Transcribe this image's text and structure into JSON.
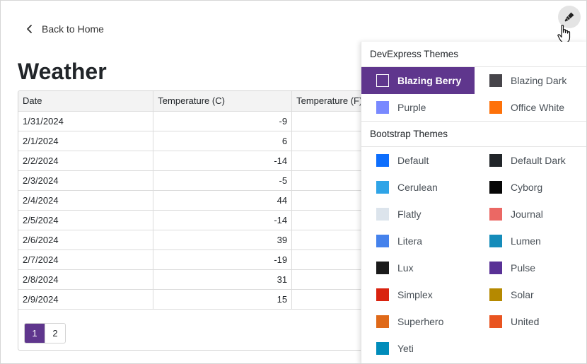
{
  "nav": {
    "back_label": "Back to Home"
  },
  "page": {
    "title": "Weather"
  },
  "grid": {
    "columns": [
      "Date",
      "Temperature (C)",
      "Temperature (F)"
    ],
    "rows": [
      {
        "date": "1/31/2024",
        "temp_c": "-9"
      },
      {
        "date": "2/1/2024",
        "temp_c": "6"
      },
      {
        "date": "2/2/2024",
        "temp_c": "-14"
      },
      {
        "date": "2/3/2024",
        "temp_c": "-5"
      },
      {
        "date": "2/4/2024",
        "temp_c": "44"
      },
      {
        "date": "2/5/2024",
        "temp_c": "-14"
      },
      {
        "date": "2/6/2024",
        "temp_c": "39"
      },
      {
        "date": "2/7/2024",
        "temp_c": "-19"
      },
      {
        "date": "2/8/2024",
        "temp_c": "31"
      },
      {
        "date": "2/9/2024",
        "temp_c": "15"
      }
    ],
    "pager": {
      "pages": [
        "1",
        "2"
      ],
      "active": "1"
    }
  },
  "theme_button_icon": "paintbrush-icon",
  "theme_panel": {
    "devexpress_header": "DevExpress Themes",
    "devexpress": [
      {
        "name": "Blazing Berry",
        "color": "#5f368d",
        "selected": true
      },
      {
        "name": "Blazing Dark",
        "color": "#46444a",
        "selected": false
      },
      {
        "name": "Purple",
        "color": "#7989ff",
        "selected": false
      },
      {
        "name": "Office White",
        "color": "#fe7109",
        "selected": false
      }
    ],
    "bootstrap_header": "Bootstrap Themes",
    "bootstrap": [
      {
        "name": "Default",
        "color": "#0d6efd"
      },
      {
        "name": "Default Dark",
        "color": "#212529"
      },
      {
        "name": "Cerulean",
        "color": "#2fa4e7"
      },
      {
        "name": "Cyborg",
        "color": "#060606"
      },
      {
        "name": "Flatly",
        "color": "#dce4ec"
      },
      {
        "name": "Journal",
        "color": "#eb6864"
      },
      {
        "name": "Litera",
        "color": "#4582ec"
      },
      {
        "name": "Lumen",
        "color": "#158cba"
      },
      {
        "name": "Lux",
        "color": "#1a1a1a"
      },
      {
        "name": "Pulse",
        "color": "#593196"
      },
      {
        "name": "Simplex",
        "color": "#d9230f"
      },
      {
        "name": "Solar",
        "color": "#b58900"
      },
      {
        "name": "Superhero",
        "color": "#df6919"
      },
      {
        "name": "United",
        "color": "#e95420"
      },
      {
        "name": "Yeti",
        "color": "#008cba"
      }
    ]
  }
}
